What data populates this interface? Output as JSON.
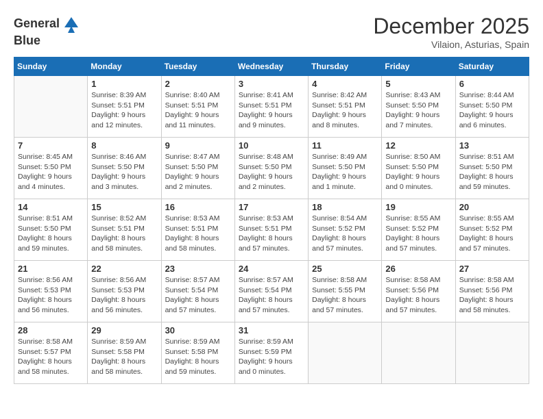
{
  "header": {
    "logo_line1": "General",
    "logo_line2": "Blue",
    "month": "December 2025",
    "location": "Vilaion, Asturias, Spain"
  },
  "weekdays": [
    "Sunday",
    "Monday",
    "Tuesday",
    "Wednesday",
    "Thursday",
    "Friday",
    "Saturday"
  ],
  "weeks": [
    [
      {
        "day": "",
        "sunrise": "",
        "sunset": "",
        "daylight": ""
      },
      {
        "day": "1",
        "sunrise": "Sunrise: 8:39 AM",
        "sunset": "Sunset: 5:51 PM",
        "daylight": "Daylight: 9 hours and 12 minutes."
      },
      {
        "day": "2",
        "sunrise": "Sunrise: 8:40 AM",
        "sunset": "Sunset: 5:51 PM",
        "daylight": "Daylight: 9 hours and 11 minutes."
      },
      {
        "day": "3",
        "sunrise": "Sunrise: 8:41 AM",
        "sunset": "Sunset: 5:51 PM",
        "daylight": "Daylight: 9 hours and 9 minutes."
      },
      {
        "day": "4",
        "sunrise": "Sunrise: 8:42 AM",
        "sunset": "Sunset: 5:51 PM",
        "daylight": "Daylight: 9 hours and 8 minutes."
      },
      {
        "day": "5",
        "sunrise": "Sunrise: 8:43 AM",
        "sunset": "Sunset: 5:50 PM",
        "daylight": "Daylight: 9 hours and 7 minutes."
      },
      {
        "day": "6",
        "sunrise": "Sunrise: 8:44 AM",
        "sunset": "Sunset: 5:50 PM",
        "daylight": "Daylight: 9 hours and 6 minutes."
      }
    ],
    [
      {
        "day": "7",
        "sunrise": "Sunrise: 8:45 AM",
        "sunset": "Sunset: 5:50 PM",
        "daylight": "Daylight: 9 hours and 4 minutes."
      },
      {
        "day": "8",
        "sunrise": "Sunrise: 8:46 AM",
        "sunset": "Sunset: 5:50 PM",
        "daylight": "Daylight: 9 hours and 3 minutes."
      },
      {
        "day": "9",
        "sunrise": "Sunrise: 8:47 AM",
        "sunset": "Sunset: 5:50 PM",
        "daylight": "Daylight: 9 hours and 2 minutes."
      },
      {
        "day": "10",
        "sunrise": "Sunrise: 8:48 AM",
        "sunset": "Sunset: 5:50 PM",
        "daylight": "Daylight: 9 hours and 2 minutes."
      },
      {
        "day": "11",
        "sunrise": "Sunrise: 8:49 AM",
        "sunset": "Sunset: 5:50 PM",
        "daylight": "Daylight: 9 hours and 1 minute."
      },
      {
        "day": "12",
        "sunrise": "Sunrise: 8:50 AM",
        "sunset": "Sunset: 5:50 PM",
        "daylight": "Daylight: 9 hours and 0 minutes."
      },
      {
        "day": "13",
        "sunrise": "Sunrise: 8:51 AM",
        "sunset": "Sunset: 5:50 PM",
        "daylight": "Daylight: 8 hours and 59 minutes."
      }
    ],
    [
      {
        "day": "14",
        "sunrise": "Sunrise: 8:51 AM",
        "sunset": "Sunset: 5:50 PM",
        "daylight": "Daylight: 8 hours and 59 minutes."
      },
      {
        "day": "15",
        "sunrise": "Sunrise: 8:52 AM",
        "sunset": "Sunset: 5:51 PM",
        "daylight": "Daylight: 8 hours and 58 minutes."
      },
      {
        "day": "16",
        "sunrise": "Sunrise: 8:53 AM",
        "sunset": "Sunset: 5:51 PM",
        "daylight": "Daylight: 8 hours and 58 minutes."
      },
      {
        "day": "17",
        "sunrise": "Sunrise: 8:53 AM",
        "sunset": "Sunset: 5:51 PM",
        "daylight": "Daylight: 8 hours and 57 minutes."
      },
      {
        "day": "18",
        "sunrise": "Sunrise: 8:54 AM",
        "sunset": "Sunset: 5:52 PM",
        "daylight": "Daylight: 8 hours and 57 minutes."
      },
      {
        "day": "19",
        "sunrise": "Sunrise: 8:55 AM",
        "sunset": "Sunset: 5:52 PM",
        "daylight": "Daylight: 8 hours and 57 minutes."
      },
      {
        "day": "20",
        "sunrise": "Sunrise: 8:55 AM",
        "sunset": "Sunset: 5:52 PM",
        "daylight": "Daylight: 8 hours and 57 minutes."
      }
    ],
    [
      {
        "day": "21",
        "sunrise": "Sunrise: 8:56 AM",
        "sunset": "Sunset: 5:53 PM",
        "daylight": "Daylight: 8 hours and 56 minutes."
      },
      {
        "day": "22",
        "sunrise": "Sunrise: 8:56 AM",
        "sunset": "Sunset: 5:53 PM",
        "daylight": "Daylight: 8 hours and 56 minutes."
      },
      {
        "day": "23",
        "sunrise": "Sunrise: 8:57 AM",
        "sunset": "Sunset: 5:54 PM",
        "daylight": "Daylight: 8 hours and 57 minutes."
      },
      {
        "day": "24",
        "sunrise": "Sunrise: 8:57 AM",
        "sunset": "Sunset: 5:54 PM",
        "daylight": "Daylight: 8 hours and 57 minutes."
      },
      {
        "day": "25",
        "sunrise": "Sunrise: 8:58 AM",
        "sunset": "Sunset: 5:55 PM",
        "daylight": "Daylight: 8 hours and 57 minutes."
      },
      {
        "day": "26",
        "sunrise": "Sunrise: 8:58 AM",
        "sunset": "Sunset: 5:56 PM",
        "daylight": "Daylight: 8 hours and 57 minutes."
      },
      {
        "day": "27",
        "sunrise": "Sunrise: 8:58 AM",
        "sunset": "Sunset: 5:56 PM",
        "daylight": "Daylight: 8 hours and 58 minutes."
      }
    ],
    [
      {
        "day": "28",
        "sunrise": "Sunrise: 8:58 AM",
        "sunset": "Sunset: 5:57 PM",
        "daylight": "Daylight: 8 hours and 58 minutes."
      },
      {
        "day": "29",
        "sunrise": "Sunrise: 8:59 AM",
        "sunset": "Sunset: 5:58 PM",
        "daylight": "Daylight: 8 hours and 58 minutes."
      },
      {
        "day": "30",
        "sunrise": "Sunrise: 8:59 AM",
        "sunset": "Sunset: 5:58 PM",
        "daylight": "Daylight: 8 hours and 59 minutes."
      },
      {
        "day": "31",
        "sunrise": "Sunrise: 8:59 AM",
        "sunset": "Sunset: 5:59 PM",
        "daylight": "Daylight: 9 hours and 0 minutes."
      },
      {
        "day": "",
        "sunrise": "",
        "sunset": "",
        "daylight": ""
      },
      {
        "day": "",
        "sunrise": "",
        "sunset": "",
        "daylight": ""
      },
      {
        "day": "",
        "sunrise": "",
        "sunset": "",
        "daylight": ""
      }
    ]
  ]
}
